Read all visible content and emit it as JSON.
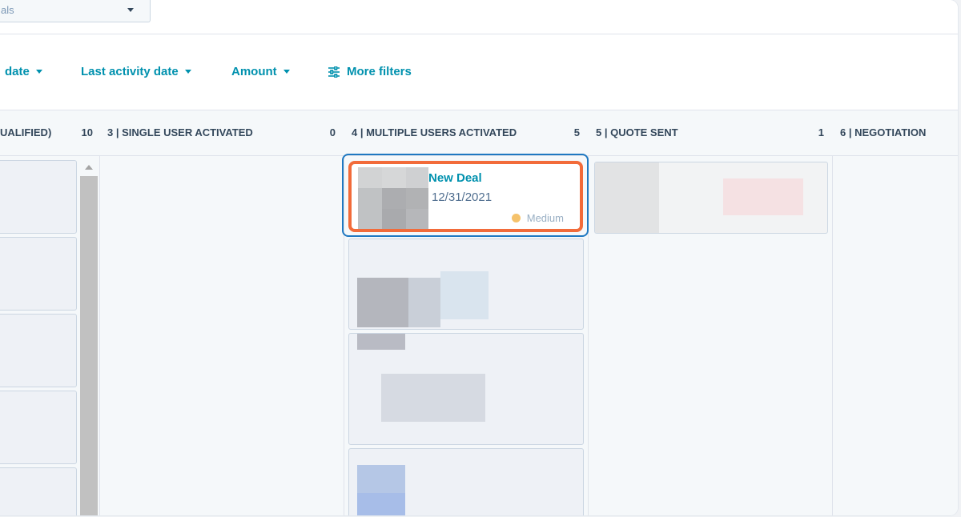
{
  "pipeline_select": {
    "label": "als"
  },
  "filters": [
    {
      "label": "date",
      "has_caret": true
    },
    {
      "label": "Last activity date",
      "has_caret": true
    },
    {
      "label": "Amount",
      "has_caret": true
    },
    {
      "label": "More filters",
      "icon": "sliders-icon"
    }
  ],
  "columns": [
    {
      "title": "UALIFIED)",
      "count": "10"
    },
    {
      "title": "3 | SINGLE USER ACTIVATED",
      "count": "0"
    },
    {
      "title": "4 | MULTIPLE USERS ACTIVATED",
      "count": "5"
    },
    {
      "title": "5 | QUOTE SENT",
      "count": "1"
    },
    {
      "title": "6 | NEGOTIATION",
      "count": ""
    }
  ],
  "highlighted_deal": {
    "name": "New Deal",
    "close_date": "12/31/2021",
    "priority": "Medium",
    "priority_color": "#f5c26b"
  },
  "colors": {
    "accent": "#0091ae",
    "highlight_outline": "#f26b3a",
    "selection_border": "#1f78c1"
  }
}
